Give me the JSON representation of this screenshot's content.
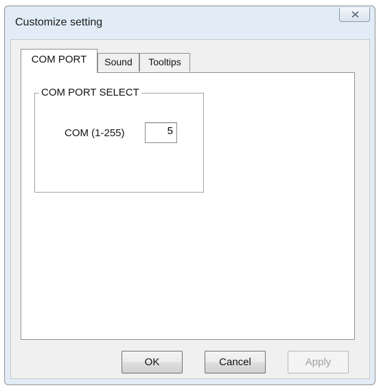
{
  "window": {
    "title": "Customize setting",
    "close_glyph": "✕"
  },
  "tabs": [
    {
      "label": "COM PORT",
      "active": true
    },
    {
      "label": "Sound",
      "active": false
    },
    {
      "label": "Tooltips",
      "active": false
    }
  ],
  "com_port": {
    "group_title": "COM PORT SELECT",
    "com_label": "COM (1-255)",
    "com_value": "5"
  },
  "buttons": {
    "ok": "OK",
    "cancel": "Cancel",
    "apply": "Apply"
  },
  "colors": {
    "frame": "#e2ecf7",
    "client": "#f0f0f0",
    "panel": "#ffffff"
  }
}
